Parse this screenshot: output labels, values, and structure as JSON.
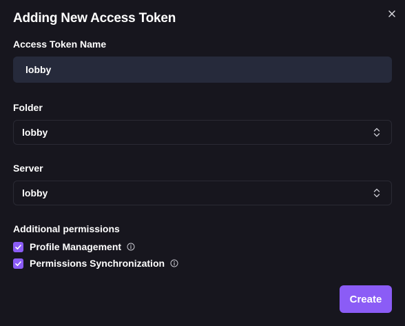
{
  "dialog": {
    "title": "Adding New Access Token",
    "close_icon": "close-icon"
  },
  "token_name": {
    "label": "Access Token Name",
    "value": "lobby"
  },
  "folder": {
    "label": "Folder",
    "selected": "lobby",
    "icon": "chevron-up-down-icon"
  },
  "server": {
    "label": "Server",
    "selected": "lobby",
    "icon": "chevron-up-down-icon"
  },
  "permissions": {
    "label": "Additional permissions",
    "items": [
      {
        "label": "Profile Management",
        "checked": true,
        "icon": "info-icon"
      },
      {
        "label": "Permissions Synchronization",
        "checked": true,
        "icon": "info-icon"
      }
    ]
  },
  "actions": {
    "create_label": "Create"
  },
  "colors": {
    "background": "#17161e",
    "input_background": "#262a3b",
    "accent": "#8b5cf6",
    "border": "#2a2a34"
  }
}
